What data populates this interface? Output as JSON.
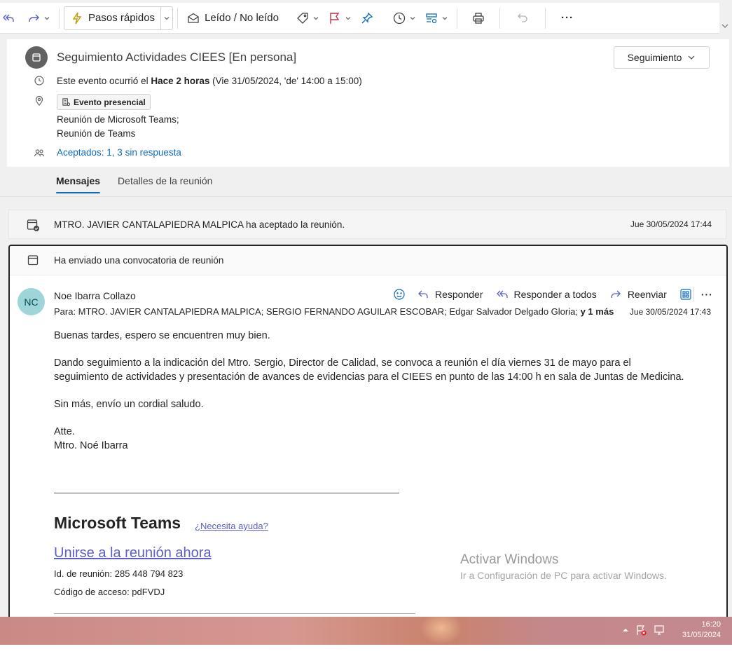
{
  "toolbar": {
    "quick_steps_label": "Pasos rápidos",
    "read_unread_label": "Leído / No leído",
    "more_label": "···"
  },
  "event": {
    "title": "Seguimiento Actividades CIEES [En persona]",
    "follow_label": "Seguimiento",
    "time_prefix": "Este evento ocurrió el",
    "time_bold": "Hace 2 horas",
    "time_detail": "(Vie 31/05/2024, 'de' 14:00 a 15:00)",
    "location_chip": "Evento presencial",
    "location_line1": "Reunión de Microsoft Teams;",
    "location_line2": "Reunión de Teams",
    "attendees": "Aceptados: 1, 3 sin respuesta"
  },
  "tabs": {
    "messages": "Mensajes",
    "details": "Detalles de la reunión"
  },
  "accepted_row": {
    "text": "MTRO. JAVIER CANTALAPIEDRA MALPICA ha aceptado la reunión.",
    "date": "Jue 30/05/2024 17:44"
  },
  "message": {
    "invite_text": "Ha enviado una convocatoria de reunión",
    "avatar_initials": "NC",
    "sender": "Noe Ibarra Collazo",
    "reply_label": "Responder",
    "reply_all_label": "Responder a todos",
    "forward_label": "Reenviar",
    "to_line": "Para:  MTRO. JAVIER CANTALAPIEDRA MALPICA;  SERGIO FERNANDO AGUILAR ESCOBAR;  Edgar Salvador Delgado Gloria; ",
    "to_more": "y 1 más",
    "date": "Jue 30/05/2024 17:43",
    "body_greeting": "Buenas tardes, espero se encuentren muy bien.",
    "body_main": "Dando seguimiento a la indicación del Mtro. Sergio, Director de Calidad, se convoca a reunión el día viernes 31 de mayo  para el seguimiento de actividades y  presentación de avances de evidencias para el CIEES en punto de las 14:00 h en sala de Juntas de Medicina.",
    "body_closing": "Sin más, envío un cordial saludo.",
    "sign_atte": "Atte.",
    "sign_name": "Mtro. Noé Ibarra",
    "teams_title": "Microsoft Teams",
    "help_link": "¿Necesita ayuda?",
    "join_link": "Unirse a la reunión ahora",
    "meeting_id": "Id. de reunión: 285 448 794 823",
    "access_code": "Código de acceso: pdFVDJ"
  },
  "watermark": {
    "line1": "Activar Windows",
    "line2": "Ir a Configuración de PC para activar Windows."
  },
  "taskbar": {
    "time": "16:20",
    "date": "31/05/2024"
  },
  "colors": {
    "accent": "#0f6cbd",
    "teams_purple": "#5b5fc7",
    "avatar_bg": "#9fd5d8",
    "flag_red": "#c4314b",
    "quick_steps_yellow": "#c19c00"
  }
}
